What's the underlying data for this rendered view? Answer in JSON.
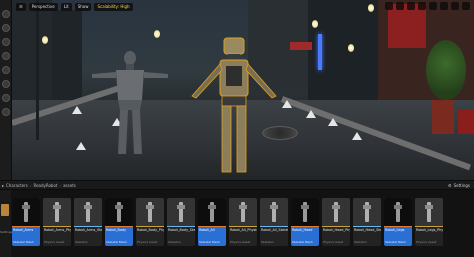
{
  "viewport": {
    "toolbar": {
      "perspective_label": "Perspective",
      "lit_label": "Lit",
      "show_label": "Show",
      "scalability_warning": "Scalability: High"
    }
  },
  "breadcrumb": {
    "items": [
      "Characters",
      "ReadyRobot",
      "assets"
    ],
    "settings_label": "Settings"
  },
  "content_browser": {
    "left_label": "Settings",
    "assets": [
      {
        "name": "Robot_Arms",
        "type": "Skeletal Mesh",
        "selected": true
      },
      {
        "name": "Robot_Arms_PhysicsAsset",
        "type": "Physics Asset",
        "selected": false
      },
      {
        "name": "Robot_Arms_Skeleton",
        "type": "Skeleton",
        "selected": false
      },
      {
        "name": "Robot_Body",
        "type": "Skeletal Mesh",
        "selected": true
      },
      {
        "name": "Robot_Body_PhysicsAsset",
        "type": "Physics Asset",
        "selected": false
      },
      {
        "name": "Robot_Body_Skeleton",
        "type": "Skeleton",
        "selected": false
      },
      {
        "name": "Robot_All",
        "type": "Skeletal Mesh",
        "selected": true
      },
      {
        "name": "Robot_All_PhysicsAsset",
        "type": "Physics Asset",
        "selected": false
      },
      {
        "name": "Robot_All_Skeleton",
        "type": "Skeleton",
        "selected": false
      },
      {
        "name": "Robot_Head",
        "type": "Skeletal Mesh",
        "selected": true
      },
      {
        "name": "Robot_Head_PhysicsAsset",
        "type": "Physics Asset",
        "selected": false
      },
      {
        "name": "Robot_Head_Skeleton",
        "type": "Skeleton",
        "selected": false
      },
      {
        "name": "Robot_Legs",
        "type": "Skeletal Mesh",
        "selected": true
      },
      {
        "name": "Robot_Legs_PhysicsAsset",
        "type": "Physics Asset",
        "selected": false
      }
    ]
  },
  "colors": {
    "selection": "#2a6fd4",
    "mesh_stripe": "#e07a2c",
    "physics_stripe": "#c8a23c",
    "skeleton_stripe": "#69b7e8"
  }
}
